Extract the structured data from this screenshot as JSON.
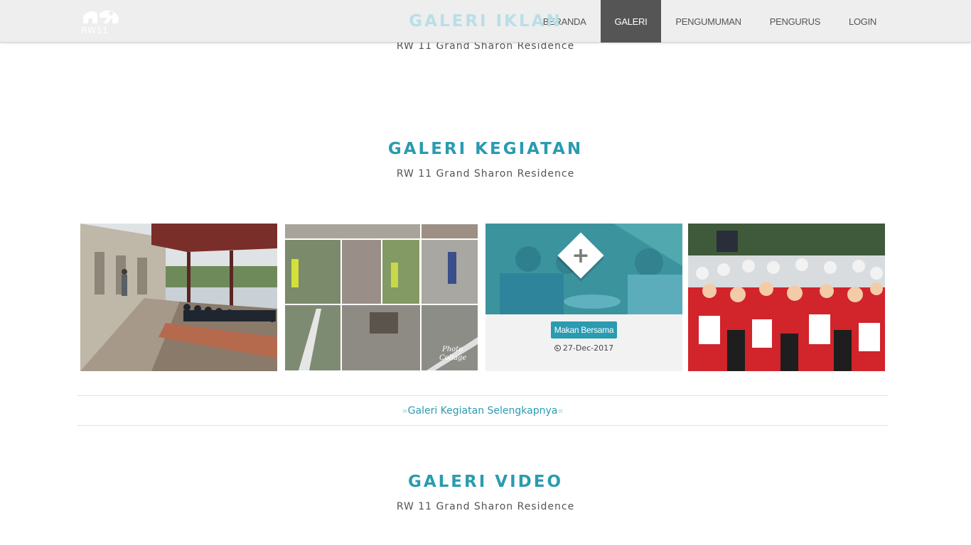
{
  "nav": {
    "logo_text": "RW11",
    "items": [
      {
        "label": "BERANDA",
        "active": false
      },
      {
        "label": "GALERI",
        "active": true
      },
      {
        "label": "PENGUMUMAN",
        "active": false
      },
      {
        "label": "PENGURUS",
        "active": false
      },
      {
        "label": "LOGIN",
        "active": false
      }
    ]
  },
  "sections": {
    "iklan": {
      "title": "GALERI IKLAN",
      "subtitle": "RW 11 Grand Sharon Residence"
    },
    "kegiatan": {
      "title": "GALERI KEGIATAN",
      "subtitle": "RW 11 Grand Sharon Residence"
    },
    "video": {
      "title": "GALERI VIDEO",
      "subtitle": "RW 11 Grand Sharon Residence"
    }
  },
  "gallery": {
    "cards": [
      {
        "kind": "photo",
        "subject": "residents gathering outdoors"
      },
      {
        "kind": "photo",
        "subject": "cleanup collage",
        "watermark": "Photo Collage"
      },
      {
        "kind": "hover",
        "subject": "people eating",
        "caption": "Makan Bersama",
        "date": "27-Dec-2017",
        "icon": "plus-icon"
      },
      {
        "kind": "photo",
        "subject": "crowd of children in red"
      }
    ]
  },
  "more_link": {
    "left_chevron": "»",
    "label": "Galeri Kegiatan Selengkapnya",
    "right_chevron": "«"
  },
  "colors": {
    "accent": "#2a9bb0",
    "navbar_bg": "#eeeeee",
    "nav_active_bg": "#555555"
  }
}
